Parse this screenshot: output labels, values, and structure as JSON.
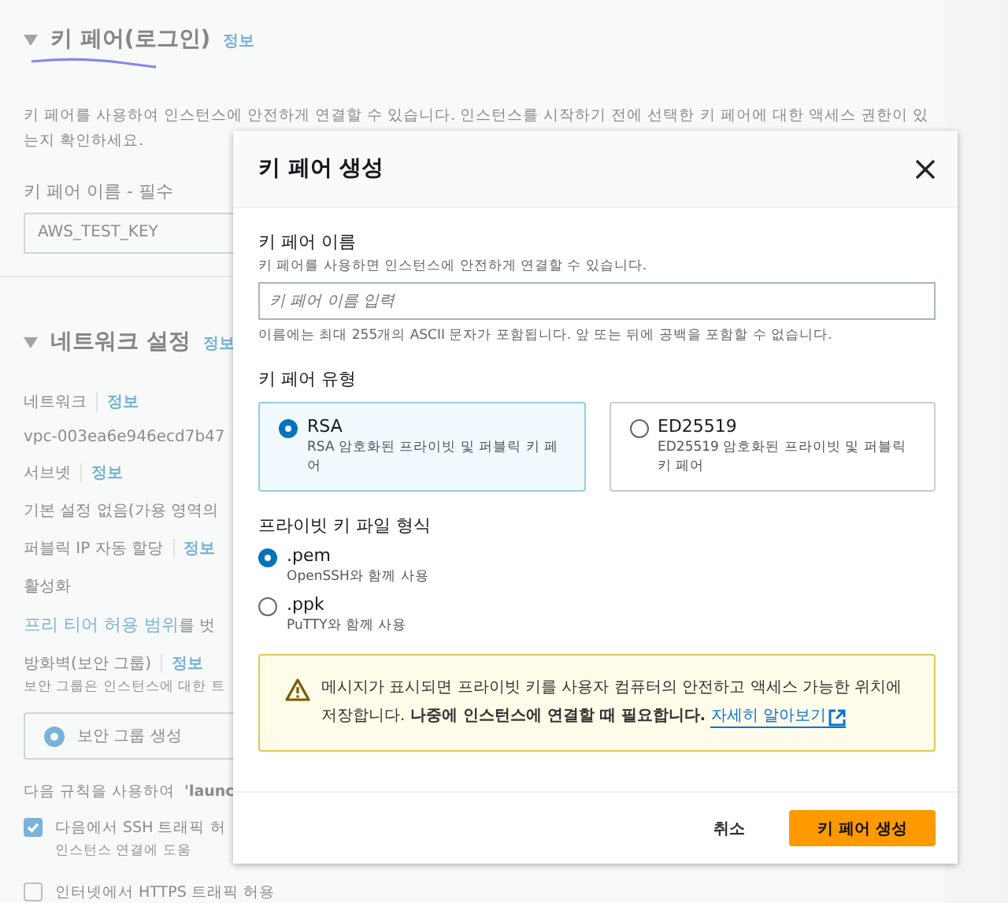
{
  "page": {
    "key_pair_section": {
      "title": "키 페어(로그인)",
      "info": "정보",
      "expanded": true,
      "description": "키 페어를 사용하여 인스턴스에 안전하게 연결할 수 있습니다. 인스턴스를 시작하기 전에 선택한 키 페어에 대한 액세스 권한이 있는지 확인하세요.",
      "field_label": "키 페어 이름 - 필수",
      "field_value": "AWS_TEST_KEY"
    },
    "network_section": {
      "title": "네트워크 설정",
      "info": "정보",
      "expanded": true,
      "rows": [
        {
          "kind": "label",
          "text": "네트워크",
          "info": "정보"
        },
        {
          "kind": "value",
          "text": "vpc-003ea6e946ecd7b47"
        },
        {
          "kind": "label",
          "text": "서브넷",
          "info": "정보"
        },
        {
          "kind": "value",
          "text": "기본 설정 없음(가용 영역의"
        },
        {
          "kind": "label",
          "text": "퍼블릭 IP 자동 할당",
          "info": "정보"
        },
        {
          "kind": "value",
          "text": "활성화"
        },
        {
          "kind": "link_note",
          "link": "프리 티어 허용 범위",
          "text": "를 벗"
        },
        {
          "kind": "label",
          "text": "방화벽(보안 그룹)",
          "info": "정보"
        },
        {
          "kind": "hint",
          "text": "보안 그룹은 인스턴스에 대한 트"
        },
        {
          "kind": "radio_box",
          "text": "보안 그룹 생성",
          "selected": true
        },
        {
          "kind": "rule",
          "prefix": "다음 규칙을 사용하여 ",
          "bold": "'launc"
        },
        {
          "kind": "checkbox",
          "text": "다음에서 SSH 트래픽 허",
          "hint": "인스턴스 연결에 도움",
          "checked": true
        },
        {
          "kind": "checkbox",
          "text": "인터넷에서 HTTPS 트래픽 허용",
          "checked": false
        }
      ]
    }
  },
  "annotation": {
    "kind": "underline"
  },
  "dialog": {
    "title": "키 페어 생성",
    "name_field": {
      "label": "키 페어 이름",
      "description": "키 페어를 사용하면 인스턴스에 안전하게 연결할 수 있습니다.",
      "placeholder": "키 페어 이름 입력",
      "constraint": "이름에는 최대 255개의 ASCII 문자가 포함됩니다. 앞 또는 뒤에 공백을 포함할 수 없습니다."
    },
    "type_label": "키 페어 유형",
    "types": [
      {
        "label": "RSA",
        "description": "RSA 암호화된 프라이빗 및 퍼블릭 키 페어",
        "selected": true
      },
      {
        "label": "ED25519",
        "description": "ED25519 암호화된 프라이빗 및 퍼블릭 키 페어",
        "selected": false
      }
    ],
    "format_label": "프라이빗 키 파일 형식",
    "formats": [
      {
        "label": ".pem",
        "description": "OpenSSH와 함께 사용",
        "selected": true
      },
      {
        "label": ".ppk",
        "description": "PuTTY와 함께 사용",
        "selected": false
      }
    ],
    "warning": {
      "text": "메시지가 표시되면 프라이빗 키를 사용자 컴퓨터의 안전하고 액세스 가능한 위치에 저장합니다. **나중에 인스턴스에 연결할 때 필요합니다.**",
      "link": "자세히 알아보기"
    },
    "buttons": {
      "cancel": "취소",
      "primary": "키 페어 생성"
    }
  }
}
